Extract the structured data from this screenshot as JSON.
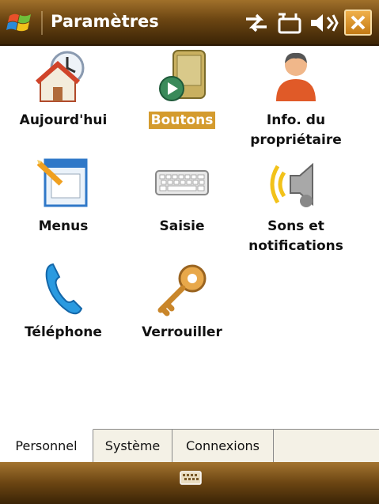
{
  "title_bar": {
    "title": "Paramètres",
    "status_icons": [
      "connectivity-icon",
      "sync-icon",
      "volume-icon"
    ],
    "close_label": "X"
  },
  "tiles": [
    {
      "label": "Aujourd'hui",
      "icon": "today-icon",
      "selected": false
    },
    {
      "label": "Boutons",
      "icon": "buttons-icon",
      "selected": true
    },
    {
      "label": "Info. du propriétaire",
      "label_line1": "Info. du",
      "label_line2": "propriétaire",
      "icon": "owner-info-icon",
      "selected": false
    },
    {
      "label": "Menus",
      "icon": "menus-icon",
      "selected": false
    },
    {
      "label": "Saisie",
      "icon": "keyboard-icon",
      "selected": false
    },
    {
      "label": "Sons et notifications",
      "label_line1": "Sons et",
      "label_line2": "notifications",
      "icon": "sounds-icon",
      "selected": false
    },
    {
      "label": "Téléphone",
      "icon": "phone-icon",
      "selected": false
    },
    {
      "label": "Verrouiller",
      "icon": "key-icon",
      "selected": false
    }
  ],
  "tabs": [
    {
      "label": "Personnel",
      "active": true
    },
    {
      "label": "Système",
      "active": false
    },
    {
      "label": "Connexions",
      "active": false
    }
  ],
  "bottom_bar": {
    "icon": "input-panel-icon"
  },
  "colors": {
    "accent": "#d49b2e",
    "bar_dark": "#3b2406",
    "bar_light": "#a0702a"
  }
}
